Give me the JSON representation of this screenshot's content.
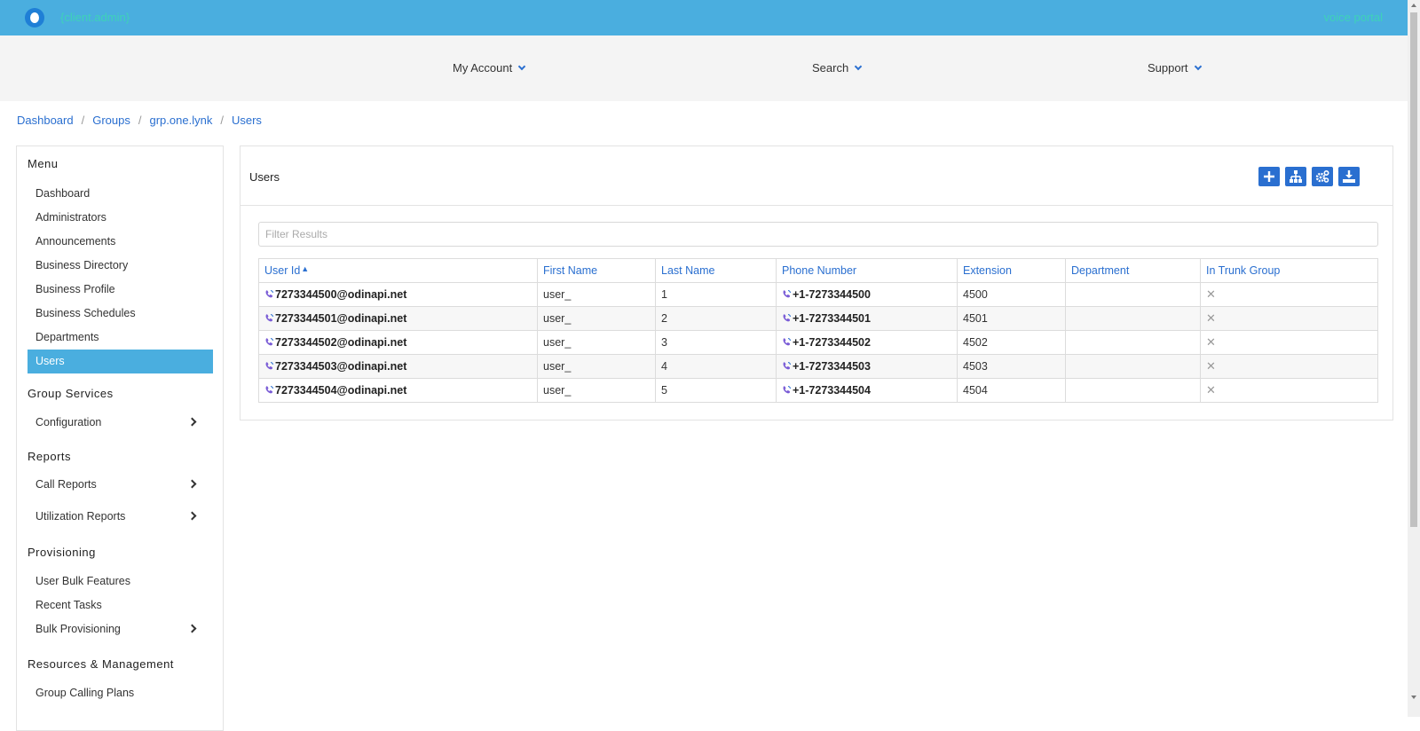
{
  "header": {
    "tenant": "{client.admin}",
    "portal": "voice portal"
  },
  "nav": {
    "my_account": "My Account",
    "search": "Search",
    "support": "Support"
  },
  "breadcrumb": [
    "Dashboard",
    "Groups",
    "grp.one.lynk",
    "Users"
  ],
  "sidebar": {
    "menu_title": "Menu",
    "menu_items": [
      "Dashboard",
      "Administrators",
      "Announcements",
      "Business Directory",
      "Business Profile",
      "Business Schedules",
      "Departments",
      "Users"
    ],
    "active_item": "Users",
    "group_services_title": "Group Services",
    "configuration": "Configuration",
    "reports_title": "Reports",
    "call_reports": "Call Reports",
    "utilization_reports": "Utilization Reports",
    "provisioning_title": "Provisioning",
    "user_bulk_features": "User Bulk Features",
    "recent_tasks": "Recent Tasks",
    "bulk_provisioning": "Bulk Provisioning",
    "resources_title": "Resources & Management",
    "group_calling_plans": "Group Calling Plans"
  },
  "panel": {
    "title": "Users",
    "tools": [
      "add-icon",
      "org-chart-icon",
      "settings-icon",
      "download-icon"
    ],
    "filter_placeholder": "Filter Results"
  },
  "table": {
    "columns": [
      "User Id",
      "First Name",
      "Last Name",
      "Phone Number",
      "Extension",
      "Department",
      "In Trunk Group"
    ],
    "sort_column": "User Id",
    "rows": [
      {
        "user_id": "7273344500@odinapi.net",
        "first_name": "user_",
        "last_name": "1",
        "phone": "+1-7273344500",
        "extension": "4500",
        "department": "",
        "in_trunk": "✕"
      },
      {
        "user_id": "7273344501@odinapi.net",
        "first_name": "user_",
        "last_name": "2",
        "phone": "+1-7273344501",
        "extension": "4501",
        "department": "",
        "in_trunk": "✕"
      },
      {
        "user_id": "7273344502@odinapi.net",
        "first_name": "user_",
        "last_name": "3",
        "phone": "+1-7273344502",
        "extension": "4502",
        "department": "",
        "in_trunk": "✕"
      },
      {
        "user_id": "7273344503@odinapi.net",
        "first_name": "user_",
        "last_name": "4",
        "phone": "+1-7273344503",
        "extension": "4503",
        "department": "",
        "in_trunk": "✕"
      },
      {
        "user_id": "7273344504@odinapi.net",
        "first_name": "user_",
        "last_name": "5",
        "phone": "+1-7273344504",
        "extension": "4504",
        "department": "",
        "in_trunk": "✕"
      }
    ]
  },
  "colors": {
    "topbar": "#4aaedf",
    "accent": "#2a6fd0",
    "active": "#4aaedf"
  }
}
